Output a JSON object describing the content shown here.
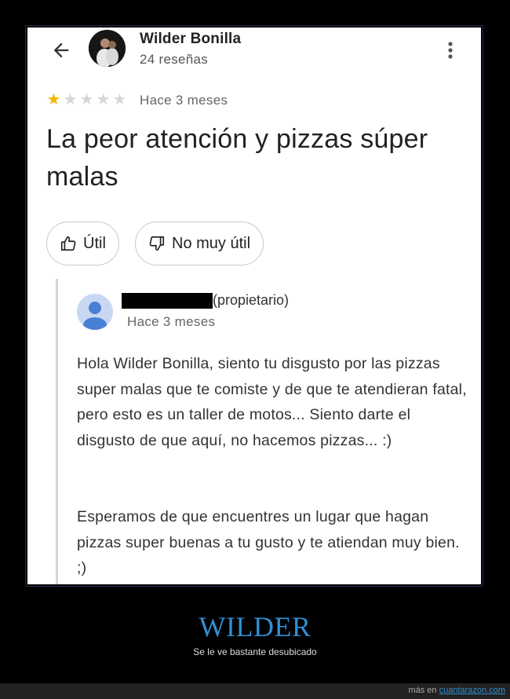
{
  "review": {
    "reviewer_name": "Wilder Bonilla",
    "review_count": "24 reseñas",
    "rating": 1,
    "rating_max": 5,
    "date": "Hace 3 meses",
    "title": "La peor atención y pizzas súper malas",
    "helpful_label": "Útil",
    "not_helpful_label": "No muy útil"
  },
  "reply": {
    "owner_label": "(propietario)",
    "date": "Hace 3 meses",
    "paragraph1": "Hola Wilder Bonilla, siento tu disgusto por las pizzas super malas que te comiste y de que te atendieran fatal, pero esto es un taller de motos... Siento darte el disgusto de que aquí, no hacemos pizzas... :)",
    "paragraph2": "Esperamos de que encuentres un lugar que hagan pizzas super buenas a tu gusto y te atiendan muy bien. ;)"
  },
  "caption": {
    "title": "WILDER",
    "subtitle": "Se le ve bastante desubicado"
  },
  "footer": {
    "prefix": "más en",
    "link": "cuantarazon.com"
  },
  "colors": {
    "star_filled": "#f5b400",
    "star_empty": "#d7d7d7",
    "caption_blue": "#2f8fd0",
    "owner_avatar_bg": "#c9d8f2",
    "owner_avatar_fg": "#4a7fd6"
  },
  "icons": {
    "back": "arrow-left-icon",
    "more": "more-vertical-icon",
    "helpful": "thumbs-up-icon",
    "not_helpful": "thumbs-down-icon",
    "owner_avatar": "person-icon"
  }
}
